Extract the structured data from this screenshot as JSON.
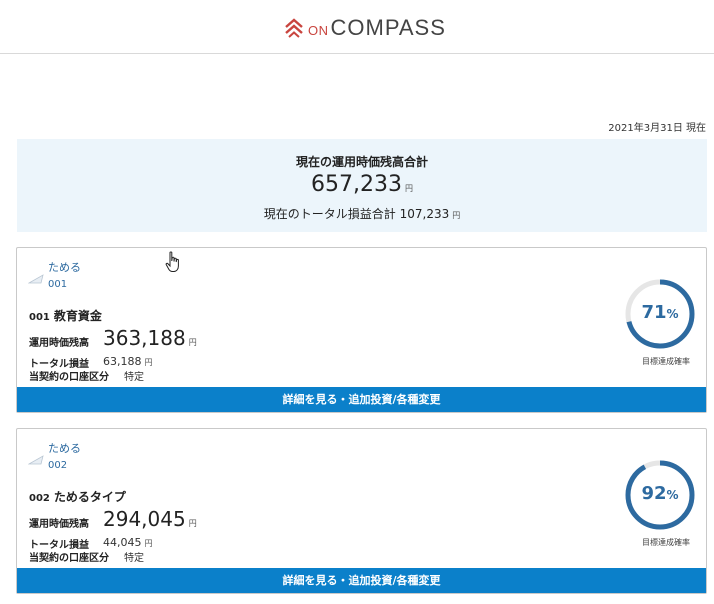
{
  "header": {
    "logo_on": "ON",
    "logo_name": "COMPASS"
  },
  "as_of": "2021年3月31日 現在",
  "summary": {
    "title": "現在の運用時価残高合計",
    "amount": "657,233",
    "currency": "円",
    "pl_label": "現在のトータル損益合計",
    "pl_amount": "107,233",
    "pl_currency": "円"
  },
  "labels": {
    "market_value": "運用時価残高",
    "total_pl": "トータル損益",
    "account_type": "当契約の口座区分",
    "gauge_caption": "目標達成確率",
    "button": "詳細を見る・追加投資/各種変更",
    "yen": "円"
  },
  "cards": [
    {
      "tag": "ためる",
      "code": "001",
      "number": "001",
      "name": "教育資金",
      "market_value": "363,188",
      "total_pl": "63,188",
      "account_type": "特定",
      "achievement_pct": 71,
      "achievement_text": "71"
    },
    {
      "tag": "ためる",
      "code": "002",
      "number": "002",
      "name": "ためるタイプ",
      "market_value": "294,045",
      "total_pl": "44,045",
      "account_type": "特定",
      "achievement_pct": 92,
      "achievement_text": "92"
    }
  ],
  "colors": {
    "accent": "#2d6aa0",
    "button": "#0b80ca",
    "summary_bg": "#ecf5fb",
    "gauge_track": "#e6e6e6",
    "logo_red": "#c9453f"
  }
}
